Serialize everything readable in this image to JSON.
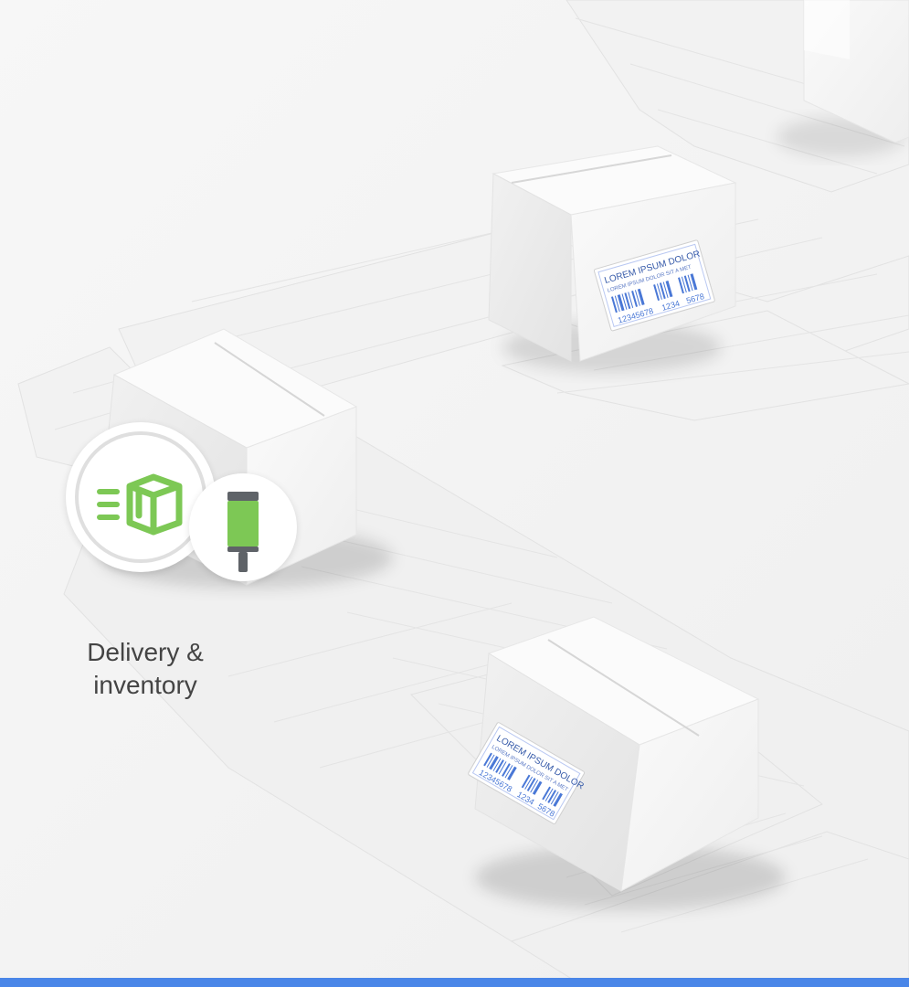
{
  "feature": {
    "label_line1": "Delivery &",
    "label_line2": "inventory",
    "main_icon": "package-delivery-icon",
    "badge_icon": "scanner-icon"
  },
  "labels": {
    "top_line1": "LOREM IPSUM DOLOR",
    "top_line2": "LOREM IPSUM DOLOR SIT A MET",
    "bottom_line1": "LOREM IPSUM DOLOR",
    "bottom_line2": "LOREM IPSUM DOLOR SIT A MET",
    "num1": "12345678",
    "num2": "1234",
    "num3": "5678"
  },
  "colors": {
    "accent_green": "#7dc855",
    "scanner_gray": "#5f6368",
    "barcode_blue": "#4a78d6",
    "bottom_bar": "#4a86e8"
  }
}
